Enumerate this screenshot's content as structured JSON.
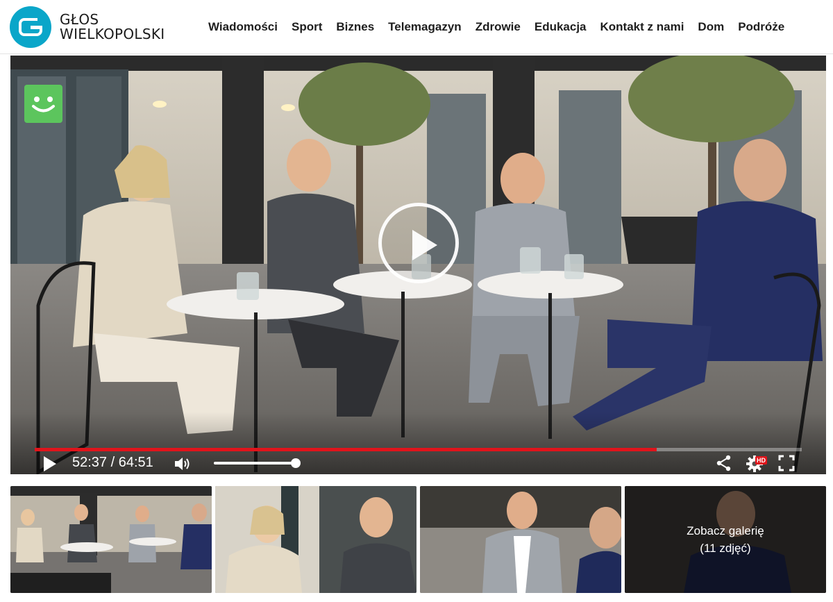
{
  "site": {
    "logo_line1": "GŁOS",
    "logo_line2": "WIELKOPOLSKI",
    "brand_color": "#0aa6c9"
  },
  "nav": {
    "items": [
      {
        "label": "Wiadomości"
      },
      {
        "label": "Sport"
      },
      {
        "label": "Biznes"
      },
      {
        "label": "Telemagazyn"
      },
      {
        "label": "Zdrowie"
      },
      {
        "label": "Edukacja"
      },
      {
        "label": "Kontakt z nami"
      },
      {
        "label": "Dom"
      },
      {
        "label": "Podróże"
      }
    ]
  },
  "player": {
    "current_time": "52:37",
    "duration": "64:51",
    "time_display": "52:37 / 64:51",
    "progress_fraction": 0.811,
    "volume_fraction": 1.0,
    "hd_label": "HD",
    "badge_color": "#5cc55d",
    "progress_color": "#e0141b",
    "icons": [
      "play-icon",
      "volume-icon",
      "share-icon",
      "settings-icon",
      "fullscreen-icon",
      "smiley-icon"
    ]
  },
  "gallery": {
    "thumbnail_count": 4,
    "cta_line1": "Zobacz galerię",
    "cta_line2": "(11 zdjęć)"
  }
}
